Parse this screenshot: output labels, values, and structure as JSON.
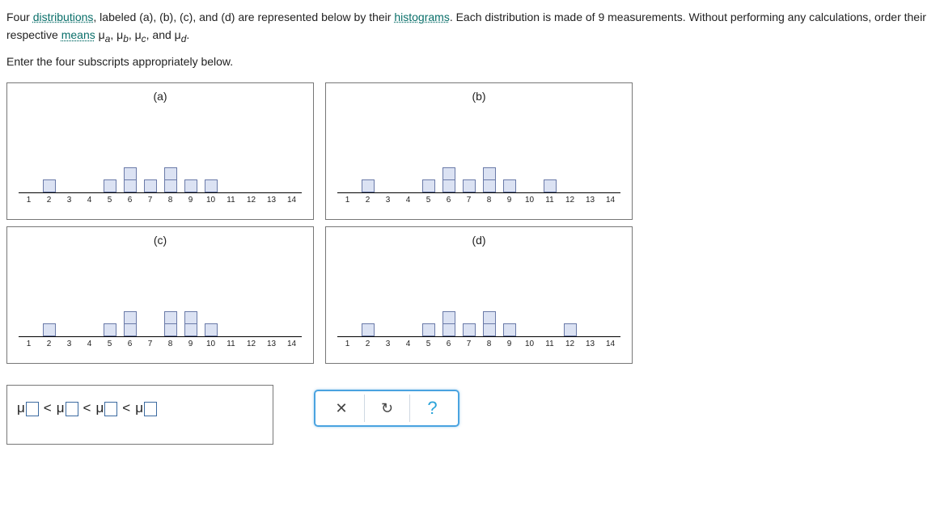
{
  "intro": {
    "t1": "Four ",
    "distributions": "distributions",
    "t2": ", labeled (a), (b), (c), and (d) are represented below by their ",
    "histograms": "histograms",
    "t3": ". Each distribution is made of 9 measurements. Without performing any calculations, order their respective ",
    "means": "means",
    "t4": " μ",
    "sa": "a",
    "t5": ", μ",
    "sb": "b",
    "t6": ", μ",
    "sc": "c",
    "t7": ", and μ",
    "sd": "d",
    "t8": "."
  },
  "subinstr": "Enter the four subscripts appropriately below.",
  "chart_data": [
    {
      "title": "(a)",
      "type": "bar",
      "categories": [
        1,
        2,
        3,
        4,
        5,
        6,
        7,
        8,
        9,
        10,
        11,
        12,
        13,
        14
      ],
      "values": [
        0,
        1,
        0,
        0,
        1,
        2,
        1,
        2,
        1,
        1,
        0,
        0,
        0,
        0
      ]
    },
    {
      "title": "(b)",
      "type": "bar",
      "categories": [
        1,
        2,
        3,
        4,
        5,
        6,
        7,
        8,
        9,
        10,
        11,
        12,
        13,
        14
      ],
      "values": [
        0,
        1,
        0,
        0,
        1,
        2,
        1,
        2,
        1,
        0,
        1,
        0,
        0,
        0
      ]
    },
    {
      "title": "(c)",
      "type": "bar",
      "categories": [
        1,
        2,
        3,
        4,
        5,
        6,
        7,
        8,
        9,
        10,
        11,
        12,
        13,
        14
      ],
      "values": [
        0,
        1,
        0,
        0,
        1,
        2,
        0,
        2,
        2,
        1,
        0,
        0,
        0,
        0
      ]
    },
    {
      "title": "(d)",
      "type": "bar",
      "categories": [
        1,
        2,
        3,
        4,
        5,
        6,
        7,
        8,
        9,
        10,
        11,
        12,
        13,
        14
      ],
      "values": [
        0,
        1,
        0,
        0,
        1,
        2,
        1,
        2,
        1,
        0,
        0,
        1,
        0,
        0
      ]
    }
  ],
  "answer": {
    "mu": "μ",
    "lt": "<"
  },
  "toolbar": {
    "clear": "✕",
    "undo": "↻",
    "help": "?"
  }
}
